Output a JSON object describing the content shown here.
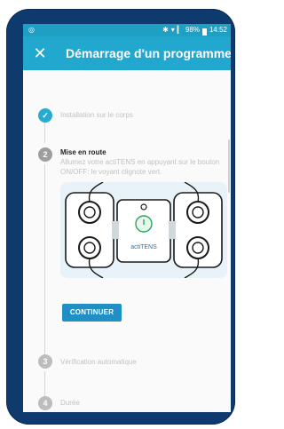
{
  "statusbar": {
    "left_icon": "android-notification-icon",
    "right_text": "✱ ▾ .┃ 98% ▮ 14:52",
    "battery": "98%",
    "time": "14:52"
  },
  "appbar": {
    "close_icon": "close-icon",
    "title": "Démarrage d'un programme"
  },
  "steps": [
    {
      "number": "✓",
      "label": "Installation sur le corps",
      "state": "done"
    },
    {
      "number": "2",
      "label": "Mise en route",
      "state": "active",
      "description": "Allumez votre actiTENS en appuyant sur le bouton ON/OFF: le voyant clignote vert."
    },
    {
      "number": "3",
      "label": "Vérification automatique",
      "state": "pending"
    },
    {
      "number": "4",
      "label": "Durée",
      "state": "pending"
    }
  ],
  "device": {
    "brand_text": "actiTENS",
    "power_icon": "power-icon"
  },
  "continue_button": {
    "label": "CONTINUER"
  },
  "colors": {
    "accent": "#22a8cf",
    "status_bar": "#1e9fc4",
    "phone_body": "#0f3a6e",
    "button": "#1f8fc4"
  }
}
